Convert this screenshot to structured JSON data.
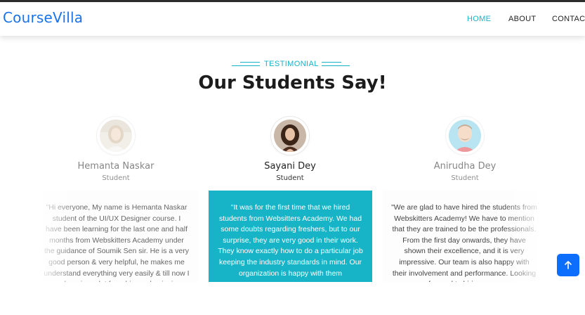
{
  "brand": "CourseVilla",
  "nav": {
    "home": "HOME",
    "about": "ABOUT",
    "contact": "CONTACT"
  },
  "section": {
    "tag": "TESTIMONIAL",
    "title": "Our Students Say!"
  },
  "testimonials": [
    {
      "name": "Hemanta Naskar",
      "role": "Student",
      "quote": "\"Hi everyone, My name is Hemanta Naskar student of the UI/UX Designer course. I have been learning for the last one and half months from Webskitters Academy under the guidance of Soumik Sen sir. He is a very good person & very helpful, he makes me understand everything very easily & till now I am learning a lot from him and enjoying"
    },
    {
      "name": "Sayani Dey",
      "role": "Student",
      "quote": "\"It was for the first time that we hired students from Websitters Academy. We had some doubts regarding freshers, but to our surprise, they are very good in their work. They know exactly how to do a particular job keeping the industry standards in mind. Our organization is happy with them"
    },
    {
      "name": "Anirudha Dey",
      "role": "Student",
      "quote": "\"We are glad to have hired the students from Webskitters Academy! We have to mention that they are trained to be the professionals. From the first day onwards, they have shown their excellence, and it is very impressive. Our team is also happy with their involvement and performance. Looking forward to hiring more"
    }
  ],
  "colors": {
    "accent": "#17b3c6",
    "brand": "#1a73e8",
    "scroll_button": "#0d6efd"
  },
  "icons": {
    "scroll_top": "arrow-up-icon"
  }
}
